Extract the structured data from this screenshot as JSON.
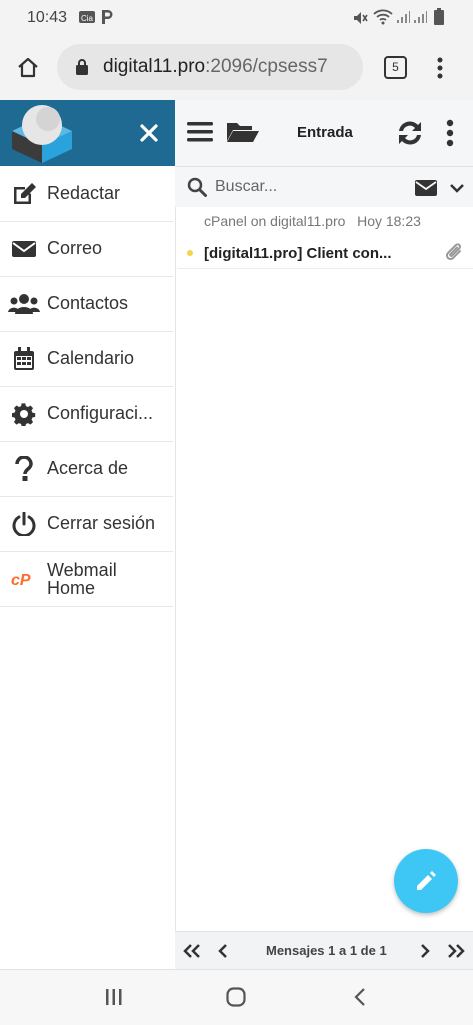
{
  "status": {
    "time": "10:43"
  },
  "browser": {
    "url_host": "digital11.pro",
    "url_rest": ":2096/cpsess7",
    "tab_count": "5"
  },
  "header": {
    "folder_title": "Entrada"
  },
  "sidebar": {
    "items": [
      {
        "label": "Redactar",
        "icon": "compose-icon"
      },
      {
        "label": "Correo",
        "icon": "envelope-icon"
      },
      {
        "label": "Contactos",
        "icon": "users-icon"
      },
      {
        "label": "Calendario",
        "icon": "calendar-icon"
      },
      {
        "label": "Configuraci...",
        "icon": "gear-icon"
      },
      {
        "label": "Acerca de",
        "icon": "question-icon"
      },
      {
        "label": "Cerrar sesión",
        "icon": "power-icon"
      },
      {
        "label": "Webmail Home",
        "icon": "cpanel-icon"
      }
    ]
  },
  "search": {
    "placeholder": "Buscar..."
  },
  "messages": [
    {
      "from": "cPanel on digital11.pro",
      "date": "Hoy 18:23",
      "subject": "[digital11.pro] Client con..."
    }
  ],
  "pager": {
    "text": "Mensajes 1 a 1 de 1"
  },
  "colors": {
    "brand": "#1f6a93",
    "fab": "#3ec7f5",
    "cpanel": "#ff6c2c",
    "unread_dot": "#f6d44a"
  }
}
